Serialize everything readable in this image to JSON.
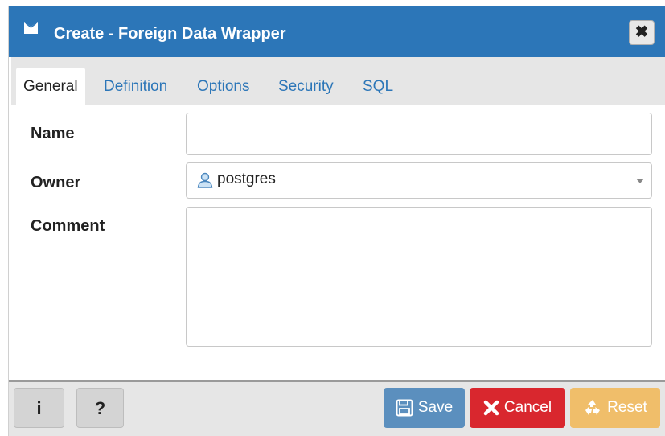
{
  "dialog": {
    "title": "Create - Foreign Data Wrapper",
    "title_icon": "foreign-data-wrapper-icon",
    "close_label": "✖"
  },
  "tabs": [
    {
      "label": "General",
      "active": true
    },
    {
      "label": "Definition",
      "active": false
    },
    {
      "label": "Options",
      "active": false
    },
    {
      "label": "Security",
      "active": false
    },
    {
      "label": "SQL",
      "active": false
    }
  ],
  "form": {
    "name": {
      "label": "Name",
      "value": ""
    },
    "owner": {
      "label": "Owner",
      "value": "postgres",
      "icon": "user-icon"
    },
    "comment": {
      "label": "Comment",
      "value": ""
    }
  },
  "footer": {
    "info_label": "i",
    "help_label": "?",
    "save_label": "Save",
    "cancel_label": "Cancel",
    "reset_label": "Reset"
  },
  "colors": {
    "title_bar": "#2c76b8",
    "link": "#2c76b8",
    "save": "#5b8fbe",
    "cancel": "#d9272e",
    "reset": "#f0be6a"
  }
}
